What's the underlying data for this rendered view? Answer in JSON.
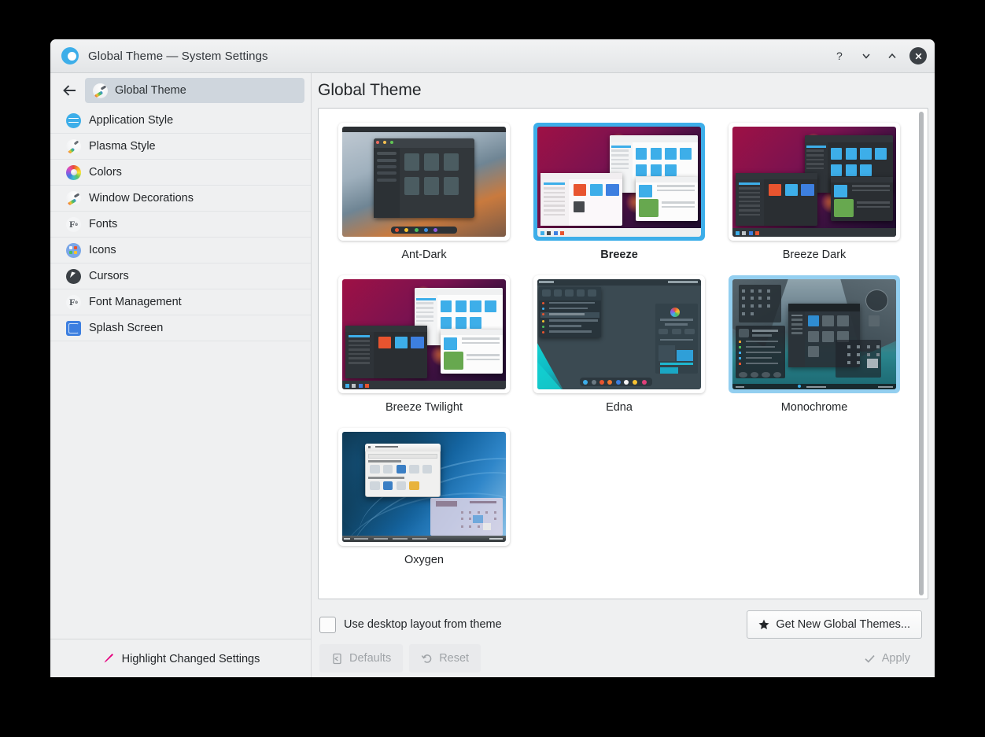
{
  "window": {
    "title": "Global Theme — System Settings",
    "app_icon": "plasma-logo-icon",
    "buttons": [
      {
        "name": "help-button",
        "glyph": "?"
      },
      {
        "name": "minimize-button",
        "glyph": "v"
      },
      {
        "name": "maximize-button",
        "glyph": "^"
      },
      {
        "name": "close-button",
        "glyph": "x"
      }
    ]
  },
  "sidebar": {
    "back_label": "Back",
    "breadcrumb": {
      "label": "Global Theme",
      "icon": "global-theme-icon"
    },
    "items": [
      {
        "label": "Application Style",
        "icon": "application-style-icon"
      },
      {
        "label": "Plasma Style",
        "icon": "plasma-style-icon"
      },
      {
        "label": "Colors",
        "icon": "colors-icon"
      },
      {
        "label": "Window Decorations",
        "icon": "window-decorations-icon"
      },
      {
        "label": "Fonts",
        "icon": "fonts-icon"
      },
      {
        "label": "Icons",
        "icon": "icons-icon"
      },
      {
        "label": "Cursors",
        "icon": "cursors-icon"
      },
      {
        "label": "Font Management",
        "icon": "font-management-icon"
      },
      {
        "label": "Splash Screen",
        "icon": "splash-screen-icon"
      }
    ],
    "footer": {
      "label": "Highlight Changed Settings",
      "icon": "brush-icon"
    }
  },
  "main": {
    "page_title": "Global Theme",
    "themes": [
      {
        "label": "Ant-Dark",
        "state": "normal",
        "style": "ant-dark"
      },
      {
        "label": "Breeze",
        "state": "selected",
        "style": "breeze"
      },
      {
        "label": "Breeze Dark",
        "state": "normal",
        "style": "breeze-dark"
      },
      {
        "label": "Breeze Twilight",
        "state": "normal",
        "style": "breeze-twilight"
      },
      {
        "label": "Edna",
        "state": "normal",
        "style": "edna"
      },
      {
        "label": "Monochrome",
        "state": "hovered",
        "style": "monochrome"
      },
      {
        "label": "Oxygen",
        "state": "normal",
        "style": "oxygen"
      }
    ],
    "scrollbar": {
      "name": "themes-vertical-scrollbar",
      "position_pct": 0
    }
  },
  "bottom": {
    "checkbox": {
      "label": "Use desktop layout from theme",
      "checked": false
    },
    "get_new_button": {
      "label": "Get New Global Themes...",
      "icon": "star-icon"
    },
    "defaults_button": {
      "label": "Defaults",
      "icon": "defaults-icon",
      "enabled": false
    },
    "reset_button": {
      "label": "Reset",
      "icon": "undo-icon",
      "enabled": false
    },
    "apply_button": {
      "label": "Apply",
      "icon": "checkmark-icon",
      "enabled": false
    }
  },
  "colors": {
    "accent": "#3daee9",
    "hover_accent": "#93cff0",
    "window_bg": "#eff0f1",
    "text": "#232629",
    "brush_pink": "#e6007e"
  }
}
